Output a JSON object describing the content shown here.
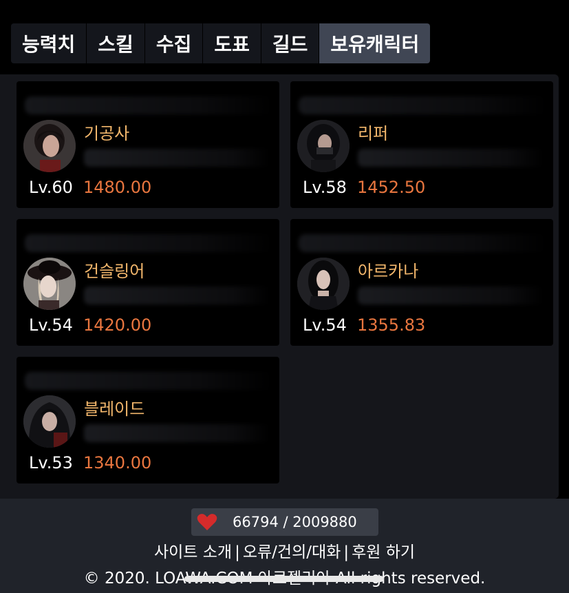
{
  "tabs": [
    {
      "label": "능력치",
      "active": false
    },
    {
      "label": "스킬",
      "active": false
    },
    {
      "label": "수집",
      "active": false
    },
    {
      "label": "도표",
      "active": false
    },
    {
      "label": "길드",
      "active": false
    },
    {
      "label": "보유캐릭터",
      "active": true
    }
  ],
  "characters": [
    {
      "class": "기공사",
      "level": "Lv.60",
      "item_level": "1480.00"
    },
    {
      "class": "리퍼",
      "level": "Lv.58",
      "item_level": "1452.50"
    },
    {
      "class": "건슬링어",
      "level": "Lv.54",
      "item_level": "1420.00"
    },
    {
      "class": "아르카나",
      "level": "Lv.54",
      "item_level": "1355.83"
    },
    {
      "class": "블레이드",
      "level": "Lv.53",
      "item_level": "1340.00"
    }
  ],
  "footer": {
    "hearts": "66794 / 2009880",
    "links": [
      "사이트 소개",
      "오류/건의/대화",
      "후원 하기"
    ],
    "copyright": "© 2020. LOAWA.COM 아르젤리아 All rights reserved."
  },
  "colors": {
    "class_name": "#f3b76c",
    "item_level": "#e9763f",
    "active_tab": "#404654"
  }
}
